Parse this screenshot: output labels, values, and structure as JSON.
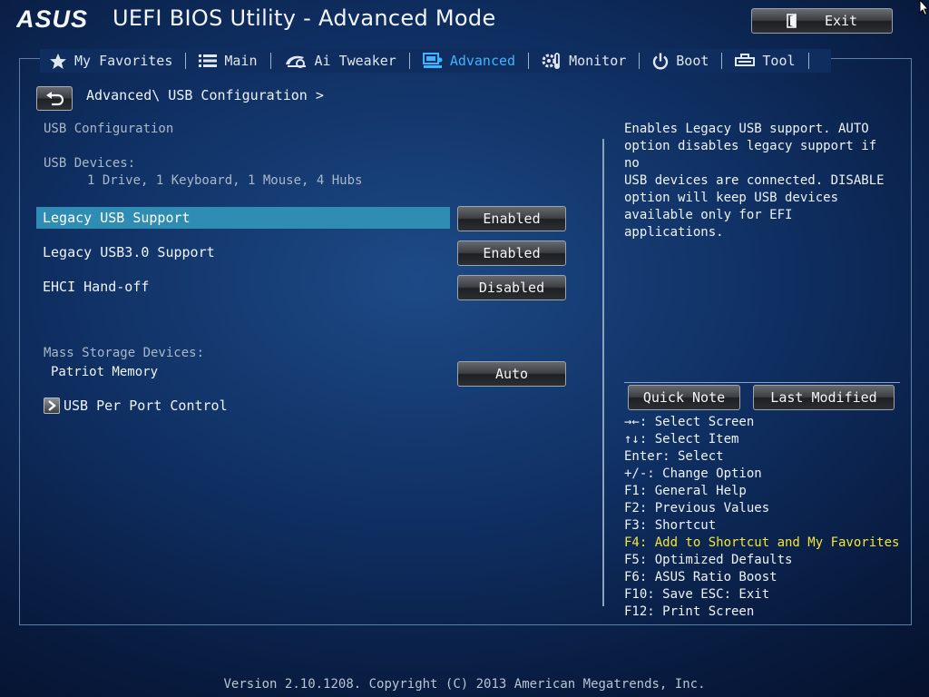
{
  "header": {
    "brand": "ASUS",
    "title": "UEFI BIOS Utility - Advanced Mode",
    "exit_label": "Exit"
  },
  "tabs": [
    {
      "label": "My Favorites",
      "icon": "star-icon"
    },
    {
      "label": "Main",
      "icon": "list-icon"
    },
    {
      "label": "Ai Tweaker",
      "icon": "tweaker-icon"
    },
    {
      "label": "Advanced",
      "icon": "advanced-icon",
      "active": true
    },
    {
      "label": "Monitor",
      "icon": "monitor-icon"
    },
    {
      "label": "Boot",
      "icon": "power-icon"
    },
    {
      "label": "Tool",
      "icon": "tool-icon"
    }
  ],
  "breadcrumb": "Advanced\\ USB Configuration >",
  "left": {
    "section_title": "USB Configuration",
    "usb_devices_label": "USB Devices:",
    "usb_devices_value": "1 Drive, 1 Keyboard, 1 Mouse, 4 Hubs",
    "settings": [
      {
        "label": "Legacy USB Support",
        "value": "Enabled"
      },
      {
        "label": "Legacy USB3.0 Support",
        "value": "Enabled"
      },
      {
        "label": "EHCI Hand-off",
        "value": "Disabled"
      }
    ],
    "mass_storage_label": "Mass Storage Devices:",
    "mass_storage_device": {
      "label": "Patriot Memory",
      "value": "Auto"
    },
    "submenu_label": "USB Per Port Control"
  },
  "right": {
    "help_text": "Enables Legacy USB support. AUTO\noption disables legacy support if no\nUSB devices are connected. DISABLE\noption will keep USB devices\navailable only for EFI applications.",
    "quick_note_label": "Quick Note",
    "last_modified_label": "Last Modified",
    "keys": [
      "→←: Select Screen",
      "↑↓: Select Item",
      "Enter: Select",
      "+/-: Change Option",
      "F1: General Help",
      "F2: Previous Values",
      "F3: Shortcut",
      "F4: Add to Shortcut and My Favorites",
      "F5: Optimized Defaults",
      "F6: ASUS Ratio Boost",
      "F10: Save  ESC: Exit",
      "F12: Print Screen"
    ]
  },
  "footer": "Version 2.10.1208. Copyright (C) 2013 American Megatrends, Inc.",
  "colors": {
    "accent": "#3fb4ff",
    "selected_row": "#2f8db3",
    "highlight_key": "#f2e537"
  }
}
